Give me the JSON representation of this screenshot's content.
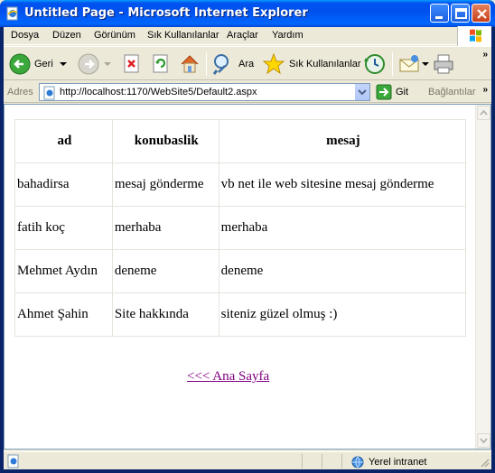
{
  "window": {
    "title": "Untitled Page - Microsoft Internet Explorer"
  },
  "menu": {
    "items": [
      "Dosya",
      "Düzen",
      "Görünüm",
      "Sık Kullanılanlar",
      "Araçlar",
      "Yardım"
    ]
  },
  "toolbar": {
    "back_label": "Geri",
    "search_label": "Ara",
    "favorites_label": "Sık Kullanılanlar"
  },
  "address": {
    "label": "Adres",
    "url": "http://localhost:1170/WebSite5/Default2.aspx",
    "go_label": "Git",
    "links_label": "Bağlantılar"
  },
  "table": {
    "headers": [
      "ad",
      "konubaslik",
      "mesaj"
    ],
    "rows": [
      [
        "bahadirsa",
        "mesaj gönderme",
        "vb net ile web sitesine mesaj gönderme"
      ],
      [
        "fatih koç",
        "merhaba",
        "merhaba"
      ],
      [
        "Mehmet Aydın",
        "deneme",
        "deneme"
      ],
      [
        "Ahmet Şahin",
        "Site hakkında",
        "siteniz güzel olmuş :)"
      ]
    ]
  },
  "page": {
    "home_link": "<<< Ana Sayfa"
  },
  "status": {
    "zone": "Yerel intranet"
  },
  "colors": {
    "titlebar": "#0053ee",
    "visited_link": "#800080",
    "window_bg": "#ece9d8"
  }
}
